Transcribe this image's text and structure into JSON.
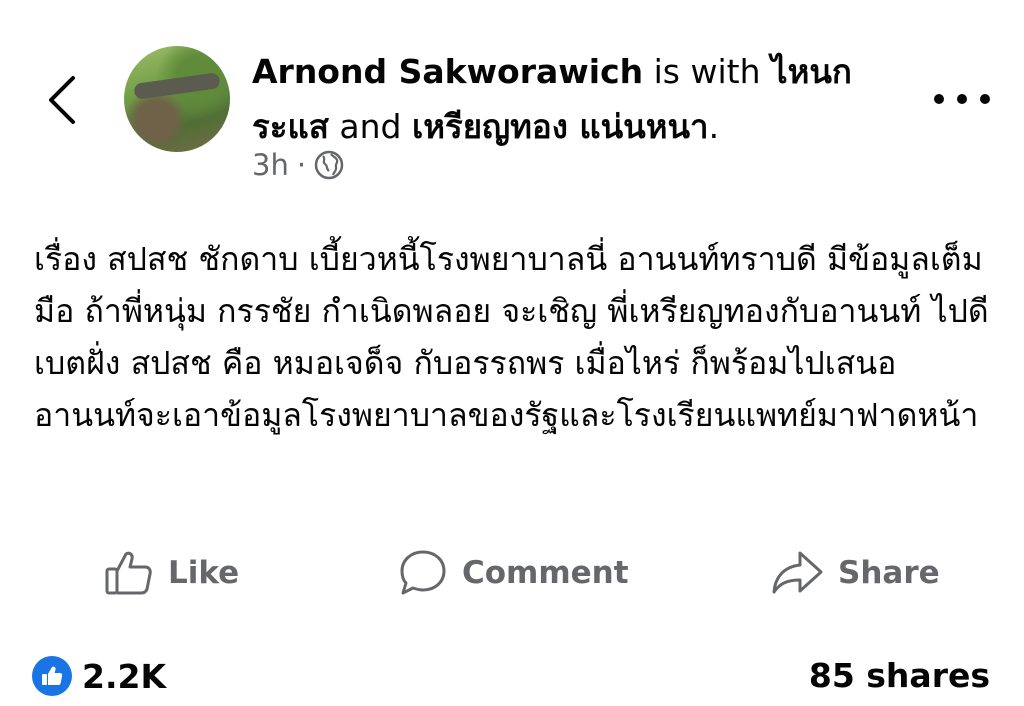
{
  "header": {
    "author": "Arnond Sakworawich",
    "with_text": " is with ",
    "tagged_1": "ไหนก ระแส",
    "and_text": " and ",
    "tagged_2": "เหรียญทอง แน่นหนา",
    "period": ".",
    "time": "3h",
    "separator": "·",
    "privacy_icon": "globe-icon"
  },
  "post": {
    "text": "เรื่อง สปสช ชักดาบ เบี้ยวหนี้โรงพยาบาลนี่ อานนท์ทราบดี มีข้อมูลเต็มมือ ถ้าพี่หนุ่ม กรรชัย กำเนิดพลอย จะเชิญ พี่เหรียญทองกับอานนท์ ไปดีเบตฝั่ง สปสช คือ หมอเจด็จ กับอรรถพร เมื่อไหร่ ก็พร้อมไปเสนอ อานนท์จะเอาข้อมูลโรงพยาบาลของรัฐและโรงเรียนแพทย์มาฟาดหน้า"
  },
  "actions": {
    "like_label": "Like",
    "comment_label": "Comment",
    "share_label": "Share"
  },
  "stats": {
    "likes_count": "2.2K",
    "shares_text": "85 shares"
  },
  "colors": {
    "accent": "#1b74e4",
    "secondary_text": "#65676b",
    "primary_text": "#050505"
  }
}
